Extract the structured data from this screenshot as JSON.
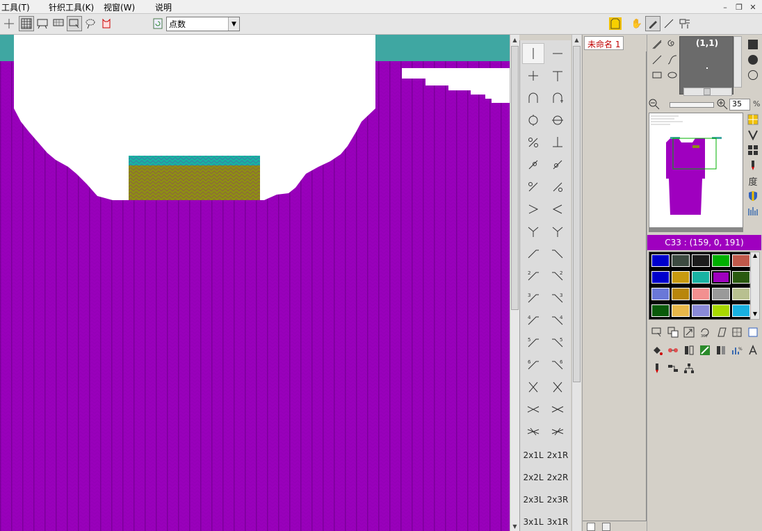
{
  "menu": {
    "items": [
      {
        "label": "工具(T)"
      },
      {
        "label": "针织工具(K)"
      },
      {
        "label": "视窗(W)"
      },
      {
        "label": "说明"
      }
    ]
  },
  "window_controls": {
    "minimize": "–",
    "restore": "❐",
    "close": "✕"
  },
  "toolbar": {
    "mode_select": {
      "value": "点数"
    }
  },
  "colors": {
    "knit_purple": "#9900BB",
    "teal": "#3FA7A2",
    "olive": "#8E8E14",
    "bright_teal": "#19B2A2"
  },
  "stitches": {
    "text_labels": [
      "2x1L",
      "2x1R",
      "2x2L",
      "2x2R",
      "2x3L",
      "2x3R",
      "3x1L",
      "3x1R"
    ]
  },
  "documents": {
    "tabs": [
      {
        "label": "未命名 1"
      }
    ]
  },
  "preview": {
    "coord": "(1,1)"
  },
  "zoom": {
    "value": "35",
    "unit": "%"
  },
  "side_icons": {
    "measure_label": "度"
  },
  "current_color": {
    "label": "C33 : (159, 0, 191)"
  },
  "palette": [
    "#0000cc",
    "#3c4a40",
    "#1c1c1c",
    "#00b000",
    "#c0584a",
    "#0000cc",
    "#c89a10",
    "#19b2a2",
    "#9f00bf",
    "#2a5a10",
    "#6a78d8",
    "#b8860b",
    "#f29090",
    "#9a9a9a",
    "#b8c090",
    "#0a5a0a",
    "#e8b84a",
    "#8a8ad8",
    "#a8d800",
    "#18b0e0"
  ]
}
